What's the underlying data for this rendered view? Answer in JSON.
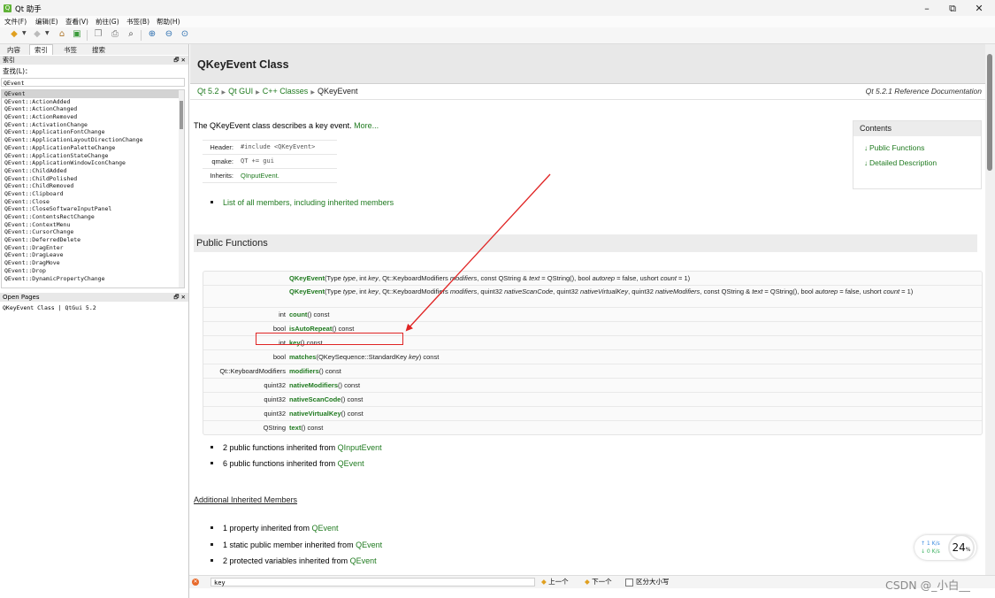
{
  "window": {
    "title": "Qt 助手",
    "minimize": "–",
    "restore": "⧉",
    "close": "✕"
  },
  "menubar": [
    "文件(F)",
    "编辑(E)",
    "查看(V)",
    "前往(G)",
    "书签(B)",
    "帮助(H)"
  ],
  "toolbar_icons": [
    "back-icon",
    "forward-icon",
    "home-icon",
    "sync-icon",
    "copy-icon",
    "print-icon",
    "find-icon",
    "zoom-in-icon",
    "zoom-out-icon",
    "zoom-reset-icon"
  ],
  "sidebar": {
    "tabs": [
      "内容",
      "索引",
      "书签",
      "搜索"
    ],
    "index_header": "索引",
    "find_label": "查找(L)：",
    "find_value": "QEvent",
    "items": [
      "QEvent",
      "QEvent::ActionAdded",
      "QEvent::ActionChanged",
      "QEvent::ActionRemoved",
      "QEvent::ActivationChange",
      "QEvent::ApplicationFontChange",
      "QEvent::ApplicationLayoutDirectionChange",
      "QEvent::ApplicationPaletteChange",
      "QEvent::ApplicationStateChange",
      "QEvent::ApplicationWindowIconChange",
      "QEvent::ChildAdded",
      "QEvent::ChildPolished",
      "QEvent::ChildRemoved",
      "QEvent::Clipboard",
      "QEvent::Close",
      "QEvent::CloseSoftwareInputPanel",
      "QEvent::ContentsRectChange",
      "QEvent::ContextMenu",
      "QEvent::CursorChange",
      "QEvent::DeferredDelete",
      "QEvent::DragEnter",
      "QEvent::DragLeave",
      "QEvent::DragMove",
      "QEvent::Drop",
      "QEvent::DynamicPropertyChange"
    ],
    "open_pages_header": "Open Pages",
    "open_pages": [
      "QKeyEvent Class | QtGui 5.2"
    ],
    "dock_controls": "🗗 ✕"
  },
  "doc": {
    "title": "QKeyEvent Class",
    "breadcrumbs": [
      "Qt 5.2",
      "Qt GUI",
      "C++ Classes",
      "QKeyEvent"
    ],
    "ref_doc": "Qt 5.2.1 Reference Documentation",
    "intro_text": "The QKeyEvent class describes a key event.",
    "intro_more": "More...",
    "header_rows": [
      {
        "key": "Header:",
        "value": "#include <QKeyEvent>"
      },
      {
        "key": "qmake:",
        "value": "QT += gui"
      },
      {
        "key": "Inherits:",
        "value": "QInputEvent."
      }
    ],
    "all_members_link": "List of all members, including inherited members",
    "contents": {
      "title": "Contents",
      "items": [
        "Public Functions",
        "Detailed Description"
      ]
    },
    "public_functions_title": "Public Functions",
    "functions": [
      {
        "ret": "",
        "name": "QKeyEvent",
        "args": "(Type type, int key, Qt::KeyboardModifiers modifiers, const QString & text = QString(), bool autorep = false, ushort count = 1)"
      },
      {
        "ret": "",
        "name": "QKeyEvent",
        "args": "(Type type, int key, Qt::KeyboardModifiers modifiers, quint32 nativeScanCode, quint32 nativeVirtualKey, quint32 nativeModifiers, const QString & text = QString(), bool autorep = false, ushort count = 1)"
      },
      {
        "ret": "int",
        "name": "count",
        "args": "() const"
      },
      {
        "ret": "bool",
        "name": "isAutoRepeat",
        "args": "() const"
      },
      {
        "ret": "int",
        "name": "key",
        "args": "() const"
      },
      {
        "ret": "bool",
        "name": "matches",
        "args": "(QKeySequence::StandardKey key) const"
      },
      {
        "ret": "Qt::KeyboardModifiers",
        "name": "modifiers",
        "args": "() const"
      },
      {
        "ret": "quint32",
        "name": "nativeModifiers",
        "args": "() const"
      },
      {
        "ret": "quint32",
        "name": "nativeScanCode",
        "args": "() const"
      },
      {
        "ret": "quint32",
        "name": "nativeVirtualKey",
        "args": "() const"
      },
      {
        "ret": "QString",
        "name": "text",
        "args": "() const"
      }
    ],
    "inherited_public": [
      {
        "prefix": "2 public functions inherited from ",
        "link": "QInputEvent"
      },
      {
        "prefix": "6 public functions inherited from ",
        "link": "QEvent"
      }
    ],
    "additional_title": "Additional Inherited Members",
    "additional": [
      {
        "prefix": "1 property inherited from ",
        "link": "QEvent"
      },
      {
        "prefix": "1 static public member inherited from ",
        "link": "QEvent"
      },
      {
        "prefix": "2 protected variables inherited from ",
        "link": "QEvent"
      }
    ]
  },
  "findbar": {
    "value": "key",
    "prev": "上一个",
    "next": "下一个",
    "case": "区分大小写"
  },
  "watermark": "CSDN @_小白__",
  "network": {
    "up": "↑ 1  K/s",
    "down": "↓ 0  K/s",
    "percent": "24",
    "percent_sign": "%"
  },
  "colors": {
    "link": "#1f7a1f",
    "highlight": "#e02424"
  }
}
